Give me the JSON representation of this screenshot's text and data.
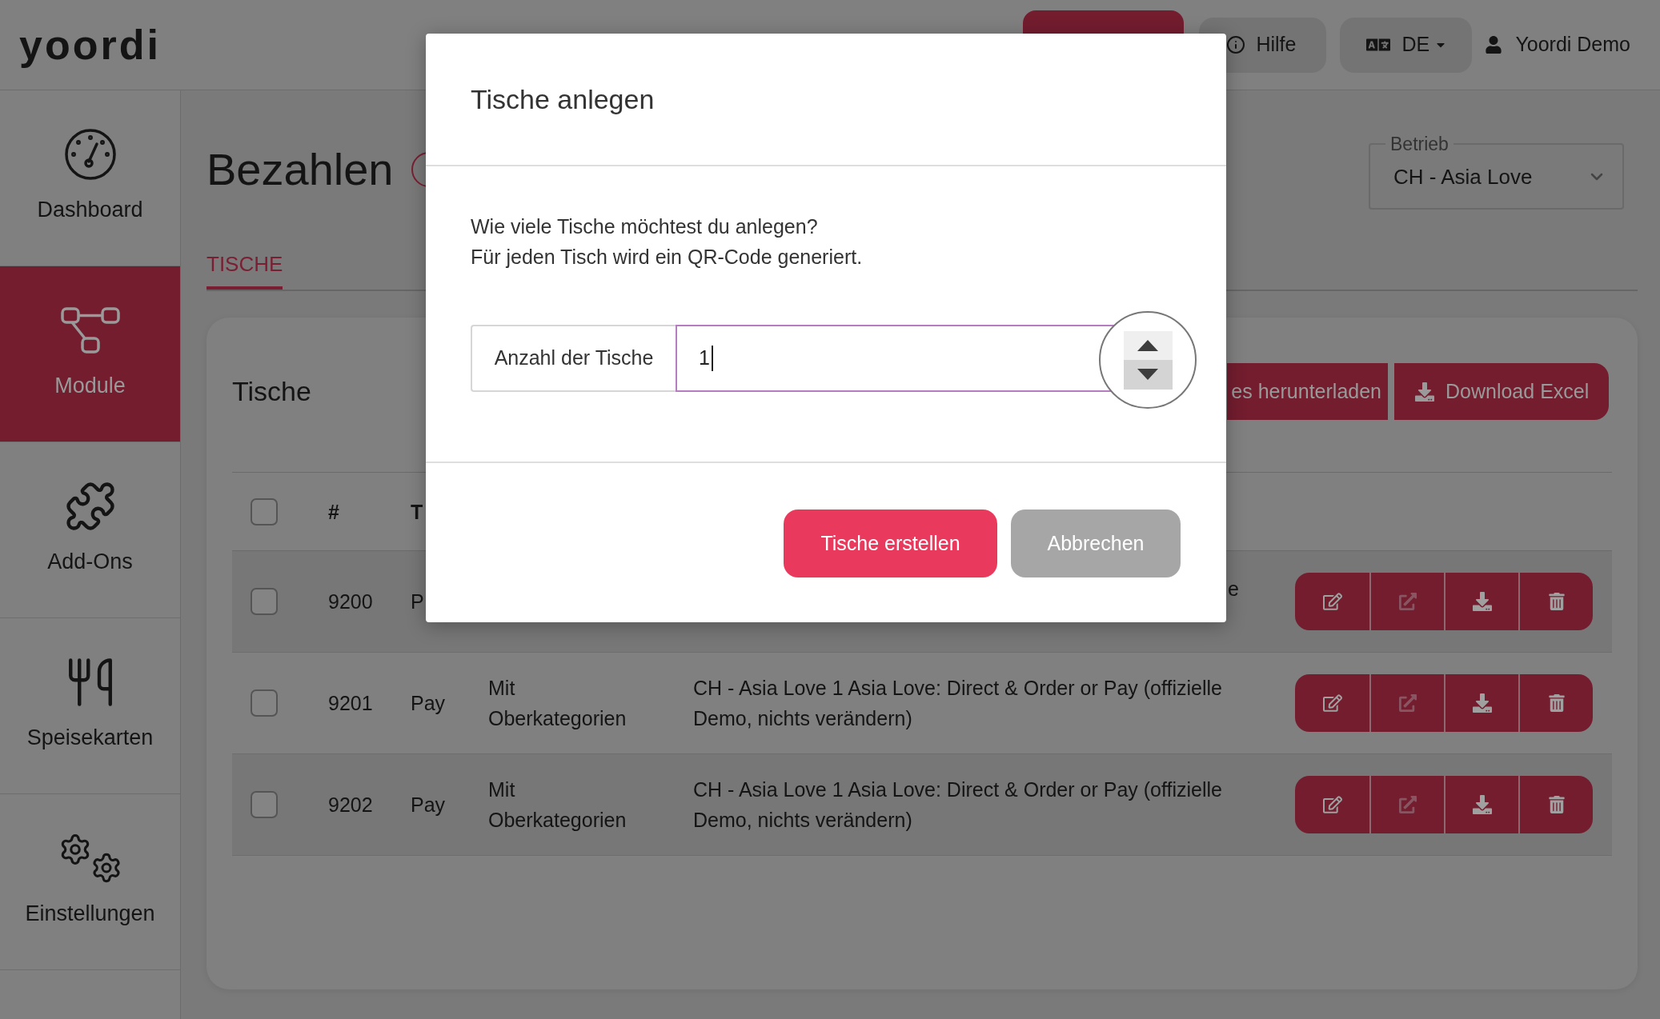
{
  "header": {
    "logo": "yoordi",
    "help": "Hilfe",
    "language": "DE",
    "user": "Yoordi Demo"
  },
  "sidebar": {
    "items": [
      {
        "label": "Dashboard",
        "selected": false
      },
      {
        "label": "Module",
        "selected": true
      },
      {
        "label": "Add-Ons",
        "selected": false
      },
      {
        "label": "Speisekarten",
        "selected": false
      },
      {
        "label": "Einstellungen",
        "selected": false
      }
    ]
  },
  "page": {
    "title": "Bezahlen",
    "location": {
      "label": "Betrieb",
      "value": "CH - Asia Love"
    }
  },
  "tabs": [
    {
      "label": "TISCHE",
      "selected": true
    }
  ],
  "card": {
    "title": "Tische",
    "buttons": [
      "es herunterladen",
      "Download Excel"
    ]
  },
  "table": {
    "select_all": {
      "checked": false
    },
    "columns": [
      "#",
      "T"
    ],
    "rows": [
      {
        "kind": "covered",
        "checked": false,
        "number": "9200",
        "column_3": "P",
        "column_5": "e",
        "actions": [
          {
            "disabled": false
          },
          {
            "disabled": true
          },
          {
            "disabled": false
          },
          {
            "disabled": false
          }
        ]
      },
      {
        "kind": "plain",
        "checked": false,
        "number": "9201",
        "column_3": "Pay",
        "column_4": "Mit Oberkategorien",
        "column_5": "CH - Asia Love 1 Asia Love: Direct & Order or Pay (offizielle Demo, nichts verändern)",
        "actions": [
          {
            "disabled": false
          },
          {
            "disabled": true
          },
          {
            "disabled": false
          },
          {
            "disabled": false
          }
        ]
      },
      {
        "kind": "plain",
        "checked": false,
        "number": "9202",
        "column_3": "Pay",
        "column_4": "Mit Oberkategorien",
        "column_5": "CH - Asia Love 1 Asia Love: Direct & Order or Pay (offizielle Demo, nichts verändern)",
        "actions": [
          {
            "disabled": false
          },
          {
            "disabled": true
          },
          {
            "disabled": false
          },
          {
            "disabled": false
          }
        ]
      }
    ]
  },
  "dialog": {
    "title": "Tische anlegen",
    "message": [
      "Wie viele Tische möchtest du anlegen?",
      "Für jeden Tisch wird ein QR-Code generiert."
    ],
    "field": {
      "label": "Anzahl der Tische",
      "value": "1"
    },
    "buttons": [
      {
        "label": "Tische erstellen",
        "kind": "primary"
      },
      {
        "label": "Abbrechen",
        "kind": "secondary"
      }
    ]
  }
}
